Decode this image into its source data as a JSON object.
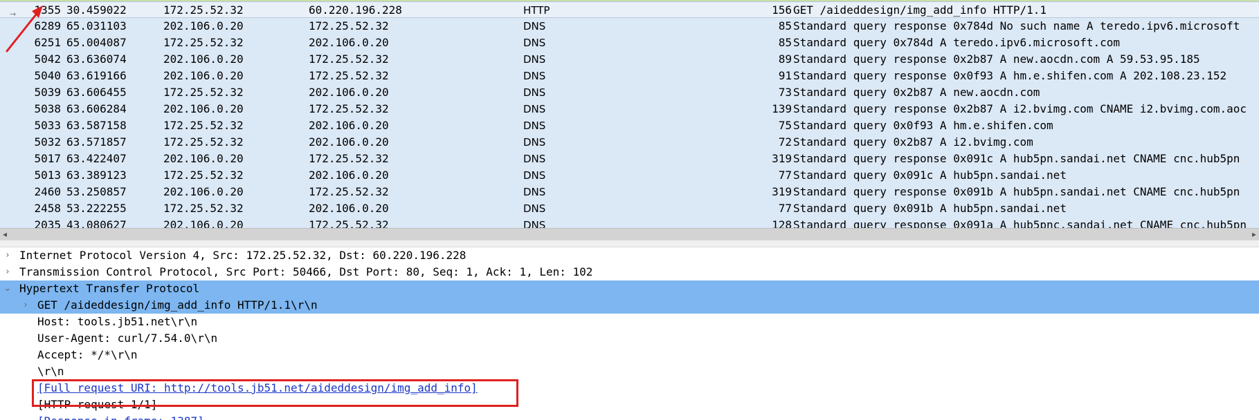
{
  "packet_list": {
    "selected_row": {
      "no": "1355",
      "time": "30.459022",
      "src": "172.25.52.32",
      "dst": "60.220.196.228",
      "proto": "HTTP",
      "len": "156",
      "info": "GET /aideddesign/img_add_info HTTP/1.1"
    },
    "rows": [
      {
        "no": "6289",
        "time": "65.031103",
        "src": "202.106.0.20",
        "dst": "172.25.52.32",
        "proto": "DNS",
        "len": "85",
        "info": "Standard query response 0x784d No such name A teredo.ipv6.microsoft"
      },
      {
        "no": "6251",
        "time": "65.004087",
        "src": "172.25.52.32",
        "dst": "202.106.0.20",
        "proto": "DNS",
        "len": "85",
        "info": "Standard query 0x784d A teredo.ipv6.microsoft.com"
      },
      {
        "no": "5042",
        "time": "63.636074",
        "src": "202.106.0.20",
        "dst": "172.25.52.32",
        "proto": "DNS",
        "len": "89",
        "info": "Standard query response 0x2b87 A new.aocdn.com A 59.53.95.185"
      },
      {
        "no": "5040",
        "time": "63.619166",
        "src": "202.106.0.20",
        "dst": "172.25.52.32",
        "proto": "DNS",
        "len": "91",
        "info": "Standard query response 0x0f93 A hm.e.shifen.com A 202.108.23.152"
      },
      {
        "no": "5039",
        "time": "63.606455",
        "src": "172.25.52.32",
        "dst": "202.106.0.20",
        "proto": "DNS",
        "len": "73",
        "info": "Standard query 0x2b87 A new.aocdn.com"
      },
      {
        "no": "5038",
        "time": "63.606284",
        "src": "202.106.0.20",
        "dst": "172.25.52.32",
        "proto": "DNS",
        "len": "139",
        "info": "Standard query response 0x2b87 A i2.bvimg.com CNAME i2.bvimg.com.aoc"
      },
      {
        "no": "5033",
        "time": "63.587158",
        "src": "172.25.52.32",
        "dst": "202.106.0.20",
        "proto": "DNS",
        "len": "75",
        "info": "Standard query 0x0f93 A hm.e.shifen.com"
      },
      {
        "no": "5032",
        "time": "63.571857",
        "src": "172.25.52.32",
        "dst": "202.106.0.20",
        "proto": "DNS",
        "len": "72",
        "info": "Standard query 0x2b87 A i2.bvimg.com"
      },
      {
        "no": "5017",
        "time": "63.422407",
        "src": "202.106.0.20",
        "dst": "172.25.52.32",
        "proto": "DNS",
        "len": "319",
        "info": "Standard query response 0x091c A hub5pn.sandai.net CNAME cnc.hub5pn"
      },
      {
        "no": "5013",
        "time": "63.389123",
        "src": "172.25.52.32",
        "dst": "202.106.0.20",
        "proto": "DNS",
        "len": "77",
        "info": "Standard query 0x091c A hub5pn.sandai.net"
      },
      {
        "no": "2460",
        "time": "53.250857",
        "src": "202.106.0.20",
        "dst": "172.25.52.32",
        "proto": "DNS",
        "len": "319",
        "info": "Standard query response 0x091b A hub5pn.sandai.net CNAME cnc.hub5pn"
      },
      {
        "no": "2458",
        "time": "53.222255",
        "src": "172.25.52.32",
        "dst": "202.106.0.20",
        "proto": "DNS",
        "len": "77",
        "info": "Standard query 0x091b A hub5pn.sandai.net"
      },
      {
        "no": "2035",
        "time": "43.080627",
        "src": "202.106.0.20",
        "dst": "172.25.52.32",
        "proto": "DNS",
        "len": "128",
        "info": "Standard query response 0x091a A hub5pnc.sandai.net CNAME cnc.hub5pn"
      }
    ]
  },
  "details": {
    "ip_line": "Internet Protocol Version 4, Src: 172.25.52.32, Dst: 60.220.196.228",
    "tcp_line": "Transmission Control Protocol, Src Port: 50466, Dst Port: 80, Seq: 1, Ack: 1, Len: 102",
    "http_line": "Hypertext Transfer Protocol",
    "get_line": "GET /aideddesign/img_add_info HTTP/1.1\\r\\n",
    "host_line": "Host: tools.jb51.net\\r\\n",
    "ua_line": "User-Agent: curl/7.54.0\\r\\n",
    "accept_line": "Accept: */*\\r\\n",
    "crlf_line": "\\r\\n",
    "full_uri_line": "[Full request URI: http://tools.jb51.net/aideddesign/img_add_info]",
    "http_request_line": "[HTTP request 1/1]",
    "response_line": "[Response in frame: 1387]"
  },
  "colors": {
    "list_bg": "#dbe8f6",
    "highlight": "#7db6f0",
    "annotation_red": "#e02020",
    "link": "#1a35c8"
  },
  "icons": {
    "collapsed": "chevron-right-icon",
    "expanded": "chevron-down-icon",
    "annotation": "red-arrow-icon"
  }
}
